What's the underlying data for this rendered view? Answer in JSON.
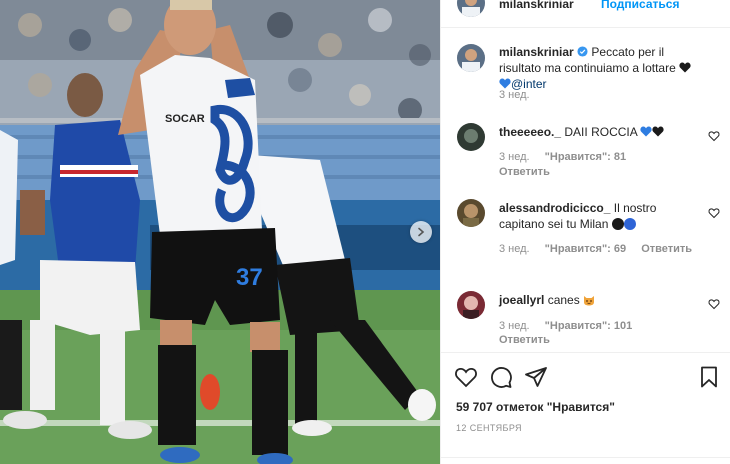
{
  "post": {
    "author": "milanskriniar",
    "follow_label": "Подписаться",
    "caption": {
      "username": "milanskriniar",
      "text": "Peccato per il risultato ma continuiamo a lottare",
      "mention": "@inter",
      "time": "3 нед."
    },
    "photo": {
      "player_number": "37",
      "sponsor_text": "SOCAR"
    },
    "likes_text": "59 707 отметок \"Нравится\"",
    "date": "12 сентября"
  },
  "comments": [
    {
      "username": "theeeeeo._",
      "text": "DAII ROCCIA",
      "time": "3 нед.",
      "likes": "\"Нравится\": 81",
      "reply": "Ответить"
    },
    {
      "username": "alessandrodicicco_",
      "text": "Il nostro capitano sei tu Milan",
      "time": "3 нед.",
      "likes": "\"Нравится\": 69",
      "reply": "Ответить"
    },
    {
      "username": "joeallyrl",
      "text": "canes",
      "time": "3 нед.",
      "likes": "\"Нравится\": 101",
      "reply": "Ответить"
    }
  ],
  "icons": {
    "like": "heart-icon",
    "comment": "comment-bubble-icon",
    "share": "paper-plane-icon",
    "save": "bookmark-icon",
    "next": "chevron-right-icon",
    "verified": "verified-badge-icon"
  },
  "colors": {
    "link_blue": "#0095f6",
    "mention_blue": "#00376b",
    "muted_gray": "#8e8e8e",
    "text": "#262626",
    "inter_blue": "#1e4fa3"
  }
}
